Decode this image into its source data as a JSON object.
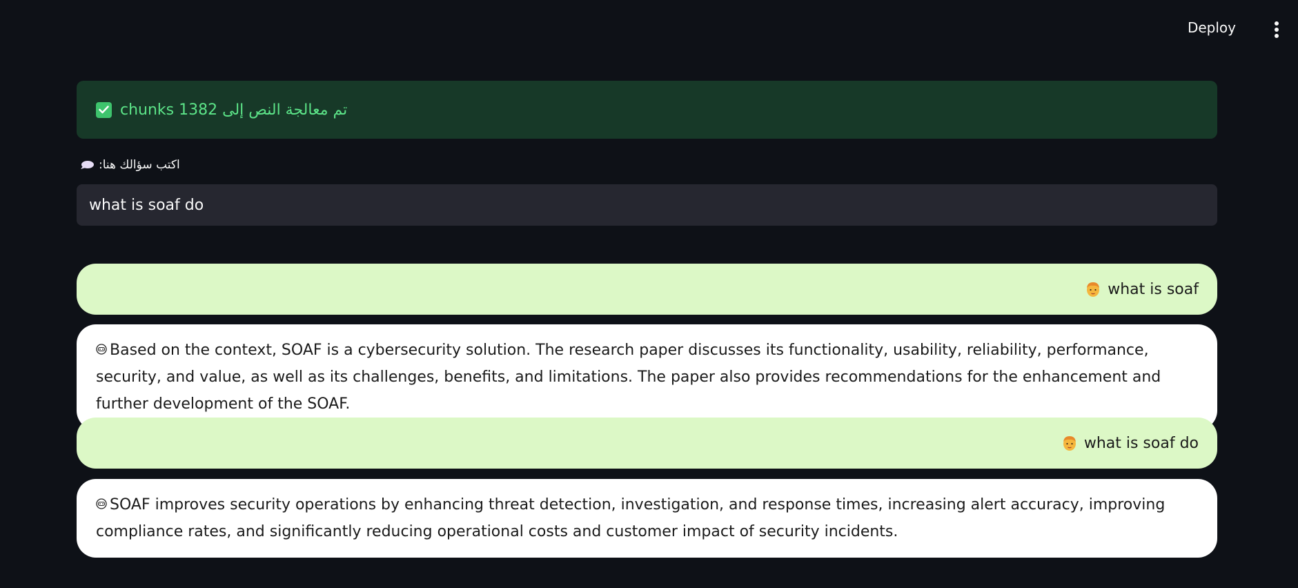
{
  "header": {
    "deploy_label": "Deploy",
    "menu_icon": "more-vert-icon"
  },
  "status": {
    "icon": "check-icon",
    "text": "تم معالجة النص إلى 1382 chunks",
    "color": "#5ce488"
  },
  "question": {
    "label": "اكتب سؤالك هنا:",
    "label_icon": "speech-bubble-icon",
    "value": "what is soaf do"
  },
  "chat": {
    "messages": [
      {
        "role": "user",
        "icon": "user-avatar-icon",
        "text": "what is soaf"
      },
      {
        "role": "assistant",
        "icon": "bot-icon",
        "text": "Based on the context, SOAF is a cybersecurity solution. The research paper discusses its functionality, usability, reliability, performance, security, and value, as well as its challenges, benefits, and limitations. The paper also provides recommendations for the enhancement and further development of the SOAF."
      },
      {
        "role": "user",
        "icon": "user-avatar-icon",
        "text": "what is soaf do"
      },
      {
        "role": "assistant",
        "icon": "bot-icon",
        "text": "SOAF improves security operations by enhancing threat detection, investigation, and response times, increasing alert accuracy, improving compliance rates, and significantly reducing operational costs and customer impact of security incidents."
      }
    ]
  },
  "colors": {
    "background": "#0e1117",
    "user_bubble": "#dcf8c6",
    "bot_bubble": "#ffffff",
    "input_bg": "#262730",
    "success_bg": "#173928"
  }
}
